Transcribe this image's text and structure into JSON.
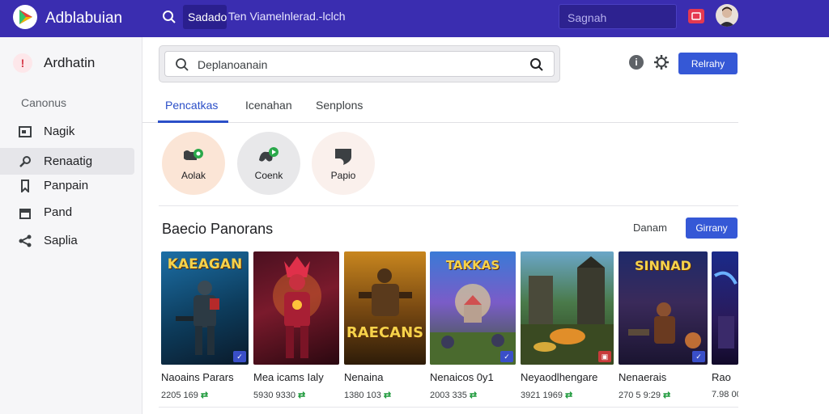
{
  "app": {
    "title": "Adblabuian"
  },
  "topbar": {
    "search_value": "Sadado",
    "search_text": "Ten  Viamelnlerad.-lclch",
    "field_placeholder": "Sagnah"
  },
  "sidebar": {
    "header": "Ardhatin",
    "section": "Canonus",
    "items": [
      {
        "label": "Nagik",
        "icon": "image-icon",
        "active": false
      },
      {
        "label": "Renaatig",
        "icon": "search-icon",
        "active": true
      },
      {
        "label": "Panpain",
        "icon": "bookmark-icon",
        "active": false
      },
      {
        "label": "Pand",
        "icon": "store-icon",
        "active": false
      },
      {
        "label": "Saplia",
        "icon": "share-icon",
        "active": false
      }
    ]
  },
  "main": {
    "search_placeholder": "Deplanoanain",
    "primary_button": "Relrahy",
    "tabs": [
      "Pencatkas",
      "Icenahan",
      "Senplons"
    ],
    "categories": [
      {
        "label": "Aolak",
        "bg": "#fbe5d6"
      },
      {
        "label": "Coenk",
        "bg": "#e8e8ea"
      },
      {
        "label": "Papio",
        "bg": "#faf0ec"
      }
    ],
    "section": {
      "title": "Baecio Panorans",
      "link": "Danam",
      "button": "Girrany"
    },
    "cards": [
      {
        "art_title": "KAEAGAN",
        "name": "Naoains Parars",
        "meta": "2205 169",
        "has_badge": true
      },
      {
        "art_title": "",
        "name": "Mea icams Ialy",
        "meta": "5930 9330",
        "has_badge": false
      },
      {
        "art_title": "RAECANS",
        "name": "Nenaina",
        "meta": "1380 103",
        "has_badge": false
      },
      {
        "art_title": "TAKKAS",
        "name": "Nenaicos 0y1",
        "meta": "2003 335",
        "has_badge": true
      },
      {
        "art_title": "",
        "name": "Neyaodlhengare",
        "meta": "3921 1969",
        "has_badge": false
      },
      {
        "art_title": "SINNAD",
        "name": "Nenaerais",
        "meta": "270 5 9:29",
        "has_badge": true
      },
      {
        "art_title": "",
        "name": "Rao",
        "meta": "7.98 00",
        "has_badge": false
      }
    ]
  },
  "colors": {
    "topbar": "#3a2db0",
    "accent": "#3558d6",
    "tab_active": "#2b4fc8",
    "tag_green": "#1e9a3c"
  }
}
